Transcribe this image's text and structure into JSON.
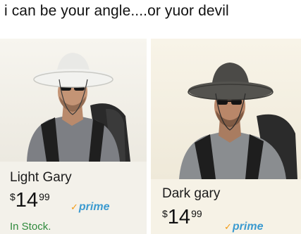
{
  "caption": "i can be your angle....or yuor devil",
  "left_product": {
    "title": "Light Gary",
    "price_currency": "$",
    "price_whole": "14",
    "price_cents": "99",
    "prime_label": "prime",
    "stock_label": "In Stock."
  },
  "right_product": {
    "title": "Dark gary",
    "price_currency": "$",
    "price_whole": "14",
    "price_cents": "99",
    "prime_label": "prime"
  },
  "colors": {
    "prime_blue": "#3c9bd0",
    "prime_check": "#f39b14",
    "in_stock_green": "#2f8a3c"
  }
}
